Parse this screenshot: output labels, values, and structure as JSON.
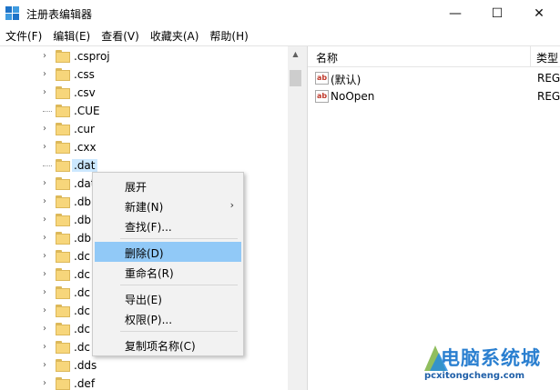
{
  "window": {
    "title": "注册表编辑器",
    "controls": {
      "minimize": "—",
      "maximize": "☐",
      "close": "✕"
    }
  },
  "menu": [
    "文件(F)",
    "编辑(E)",
    "查看(V)",
    "收藏夹(A)",
    "帮助(H)"
  ],
  "tree": {
    "items": [
      {
        "label": ".csproj",
        "expandable": true
      },
      {
        "label": ".css",
        "expandable": true
      },
      {
        "label": ".csv",
        "expandable": true
      },
      {
        "label": ".CUE",
        "expandable": false
      },
      {
        "label": ".cur",
        "expandable": true
      },
      {
        "label": ".cxx",
        "expandable": true
      },
      {
        "label": ".dat",
        "expandable": false,
        "selected": true
      },
      {
        "label": ".dat",
        "expandable": true
      },
      {
        "label": ".db",
        "expandable": true
      },
      {
        "label": ".db",
        "expandable": true
      },
      {
        "label": ".db",
        "expandable": true
      },
      {
        "label": ".dc",
        "expandable": true
      },
      {
        "label": ".dc",
        "expandable": true
      },
      {
        "label": ".dc",
        "expandable": true
      },
      {
        "label": ".dc",
        "expandable": true
      },
      {
        "label": ".dc",
        "expandable": true
      },
      {
        "label": ".dc",
        "expandable": true
      },
      {
        "label": ".dds",
        "expandable": true
      },
      {
        "label": ".def",
        "expandable": true
      }
    ]
  },
  "list": {
    "columns": {
      "name": "名称",
      "type": "类型"
    },
    "rows": [
      {
        "name": "(默认)",
        "type": "REG"
      },
      {
        "name": "NoOpen",
        "type": "REG"
      }
    ]
  },
  "context_menu": {
    "expand": "展开",
    "new": "新建(N)",
    "find": "查找(F)...",
    "delete": "删除(D)",
    "rename": "重命名(R)",
    "export": "导出(E)",
    "permissions": "权限(P)...",
    "copy_key_name": "复制项名称(C)"
  },
  "watermark": {
    "main": "电脑系统城",
    "sub": "pcxitongcheng.com"
  },
  "colors": {
    "hover": "#91c9f7",
    "selected": "#cce8ff",
    "folder": "#f7d67b"
  }
}
